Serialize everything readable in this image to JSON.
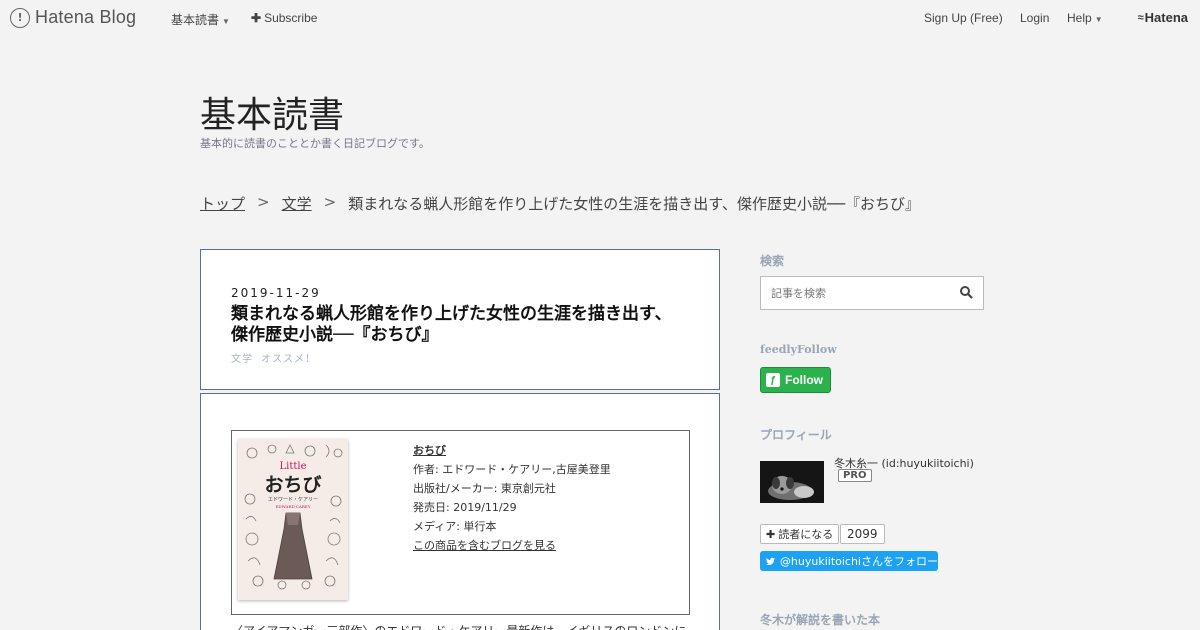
{
  "topbar": {
    "brand": "Hatena Blog",
    "menu_reading": "基本読書",
    "subscribe": "Subscribe",
    "signup": "Sign Up (Free)",
    "login": "Login",
    "help": "Help",
    "hatena": "Hatena"
  },
  "blog": {
    "title": "基本読書",
    "description": "基本的に読書のこととか書く日記ブログです。"
  },
  "breadcrumb": {
    "top": "トップ",
    "category": "文学",
    "current": "類まれなる蝋人形館を作り上げた女性の生涯を描き出す、傑作歴史小説──『おちび』",
    "separator": ">"
  },
  "article": {
    "date": "2019-11-29",
    "title": "類まれなる蝋人形館を作り上げた女性の生涯を描き出す、傑作歴史小説──『おちび』",
    "categories": [
      "文学",
      "オススメ！"
    ],
    "product": {
      "name": "おちび",
      "author": "作者: エドワード・ケアリー,古屋美登里",
      "publisher": "出版社/メーカー: 東京創元社",
      "release": "発売日: 2019/11/29",
      "media": "メディア: 単行本",
      "blog_link": "この商品を含むブログを見る",
      "cover_title_en": "Little",
      "cover_title_ja": "おちび",
      "cover_author": "エドワード・ケアリー",
      "cover_author_en": "EDWARD CAREY"
    },
    "body_first_line": "〈アイアマンガー三部作〉のエドワード・ケアリー最新作は、イギリスのロンドンに"
  },
  "sidebar": {
    "search_heading": "検索",
    "search_placeholder": "記事を検索",
    "feedly_heading": "feedlyFollow",
    "follow_label": "Follow",
    "profile_heading": "プロフィール",
    "profile_name": "冬木糸一 (id:huyukiitoichi)",
    "pro_badge": "PRO",
    "reader_label": "読者になる",
    "reader_count": "2099",
    "twitter_label": "@huyukiitoichiさんをフォロー",
    "books_heading": "冬木が解説を書いた本"
  },
  "colors": {
    "background": "#f3f3f3",
    "article_border": "#5c6e8a",
    "sidebar_heading": "#9aa5b5",
    "feedly_green": "#2bb24c",
    "twitter_blue": "#1da1f2"
  }
}
